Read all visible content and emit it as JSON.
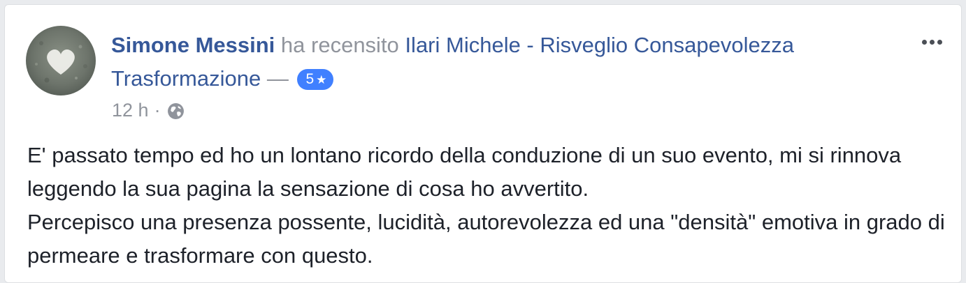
{
  "post": {
    "author": "Simone Messini",
    "verb": "ha recensito",
    "page_name": "Ilari Michele - Risveglio Consapevolezza Trasformazione",
    "dash": "—",
    "rating": {
      "value": "5",
      "star": "★",
      "max": 5,
      "color": "#4080ff"
    },
    "time": "12 h",
    "separator": "·",
    "audience_icon": "globe-icon",
    "more_icon": "more-options-icon",
    "review_paragraphs": [
      "E' passato tempo ed ho un lontano ricordo della conduzione di un suo evento, mi si rinnova leggendo la sua pagina la sensazione di cosa ho avvertito.",
      "Percepisco una presenza possente, lucidità, autorevolezza ed una \"densità\" emotiva in grado di permeare e trasformare con questo."
    ]
  },
  "colors": {
    "link": "#365899",
    "muted": "#90949c",
    "text": "#1d2129",
    "card_background": "#ffffff",
    "page_background": "#e9ebee"
  }
}
